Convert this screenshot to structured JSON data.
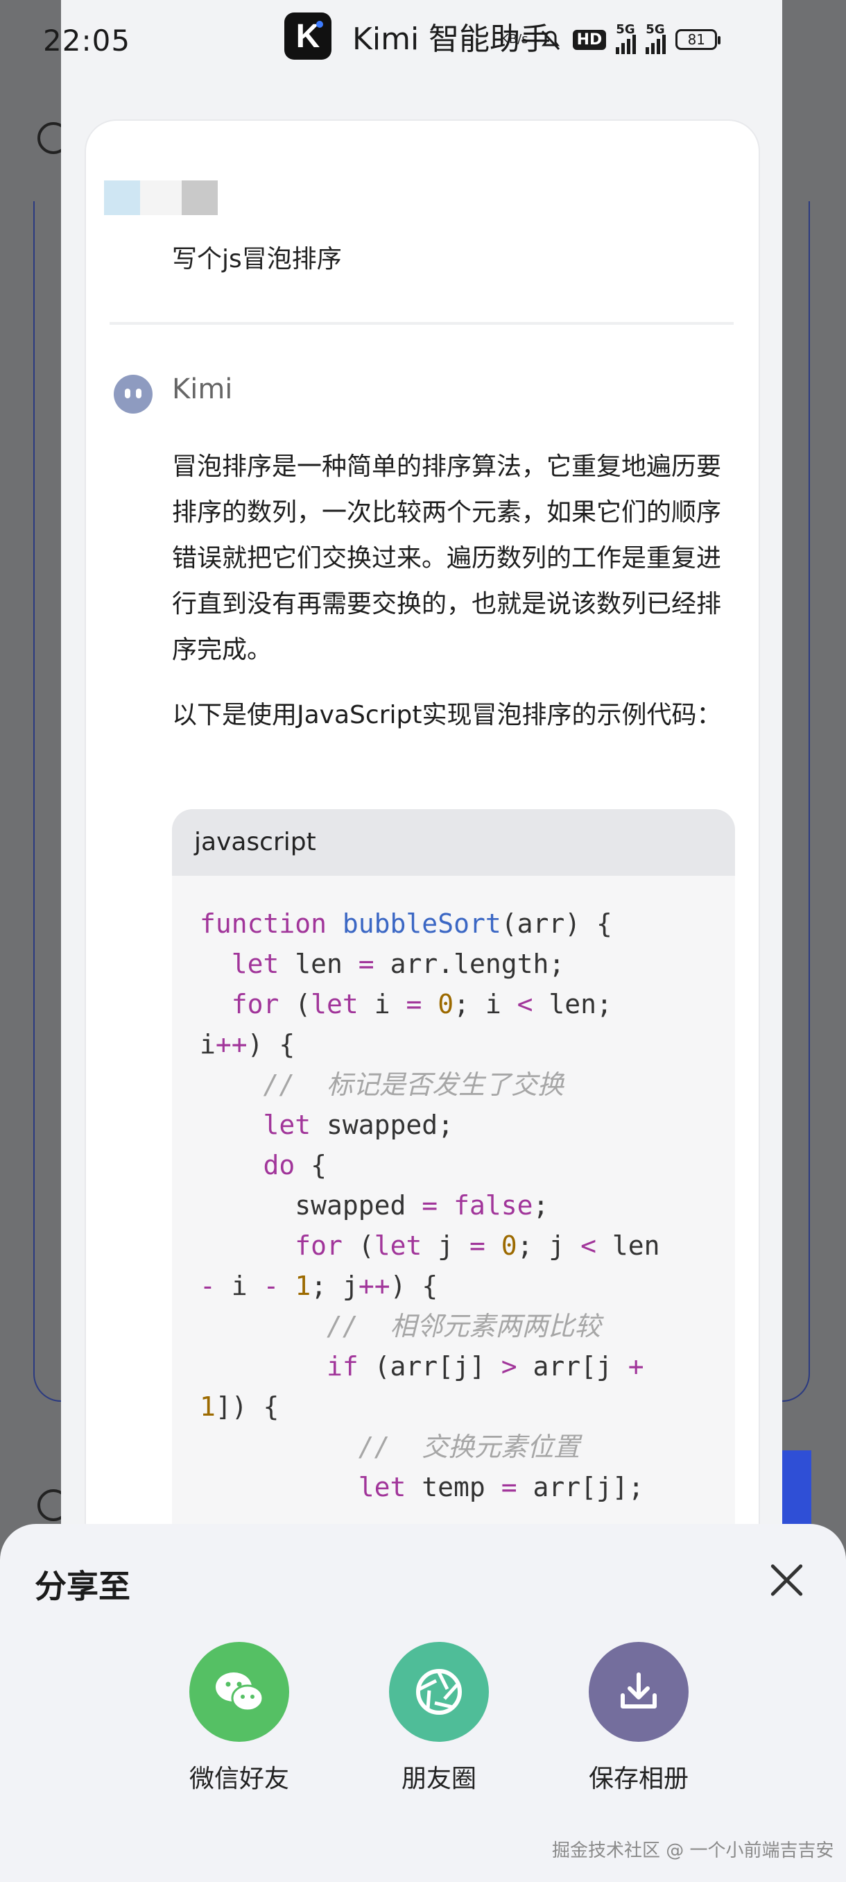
{
  "status_bar": {
    "time": "22:05",
    "net_speed": "KB/s",
    "hd_badge": "HD",
    "signal_label_1": "5G",
    "signal_label_2": "5G",
    "battery": "81"
  },
  "app": {
    "logo_letter": "K",
    "title": "Kimi 智能助手"
  },
  "chat": {
    "user_message": "写个js冒泡排序",
    "assistant_name": "Kimi",
    "paragraph_1": "冒泡排序是一种简单的排序算法，它重复地遍历要排序的数列，一次比较两个元素，如果它们的顺序错误就把它们交换过来。遍历数列的工作是重复进行直到没有再需要交换的，也就是说该数列已经排序完成。",
    "paragraph_2": "以下是使用JavaScript实现冒泡排序的示例代码：",
    "code_language": "javascript",
    "code_lines": [
      [
        [
          "kw",
          "function"
        ],
        [
          "",
          " "
        ],
        [
          "fn",
          "bubbleSort"
        ],
        [
          "",
          "(arr) {"
        ]
      ],
      [
        [
          "",
          "  "
        ],
        [
          "kw",
          "let"
        ],
        [
          "",
          " len "
        ],
        [
          "kw",
          "="
        ],
        [
          "",
          " arr.length;"
        ]
      ],
      [
        [
          "",
          "  "
        ],
        [
          "kw",
          "for"
        ],
        [
          "",
          " ("
        ],
        [
          "kw",
          "let"
        ],
        [
          "",
          " i "
        ],
        [
          "kw",
          "="
        ],
        [
          "",
          " "
        ],
        [
          "num",
          "0"
        ],
        [
          "",
          "; i "
        ],
        [
          "kw",
          "<"
        ],
        [
          "",
          " len;"
        ]
      ],
      [
        [
          "",
          "i"
        ],
        [
          "kw",
          "++"
        ],
        [
          "",
          ") {"
        ]
      ],
      [
        [
          "",
          "    "
        ],
        [
          "cm",
          "//  标记是否发生了交换"
        ]
      ],
      [
        [
          "",
          "    "
        ],
        [
          "kw",
          "let"
        ],
        [
          "",
          " swapped;"
        ]
      ],
      [
        [
          "",
          "    "
        ],
        [
          "kw",
          "do"
        ],
        [
          "",
          " {"
        ]
      ],
      [
        [
          "",
          "      swapped "
        ],
        [
          "kw",
          "="
        ],
        [
          "",
          " "
        ],
        [
          "bool",
          "false"
        ],
        [
          "",
          ";"
        ]
      ],
      [
        [
          "",
          "      "
        ],
        [
          "kw",
          "for"
        ],
        [
          "",
          " ("
        ],
        [
          "kw",
          "let"
        ],
        [
          "",
          " j "
        ],
        [
          "kw",
          "="
        ],
        [
          "",
          " "
        ],
        [
          "num",
          "0"
        ],
        [
          "",
          "; j "
        ],
        [
          "kw",
          "<"
        ],
        [
          "",
          " len"
        ]
      ],
      [
        [
          "kw",
          "-"
        ],
        [
          "",
          " i "
        ],
        [
          "kw",
          "-"
        ],
        [
          "",
          " "
        ],
        [
          "num",
          "1"
        ],
        [
          "",
          "; j"
        ],
        [
          "kw",
          "++"
        ],
        [
          "",
          ") {"
        ]
      ],
      [
        [
          "",
          "        "
        ],
        [
          "cm",
          "//  相邻元素两两比较"
        ]
      ],
      [
        [
          "",
          "        "
        ],
        [
          "kw",
          "if"
        ],
        [
          "",
          " (arr[j] "
        ],
        [
          "kw",
          ">"
        ],
        [
          "",
          " arr[j "
        ],
        [
          "kw",
          "+"
        ]
      ],
      [
        [
          "num",
          "1"
        ],
        [
          "",
          "]) {"
        ]
      ],
      [
        [
          "",
          "          "
        ],
        [
          "cm",
          "//  交换元素位置"
        ]
      ],
      [
        [
          "",
          "          "
        ],
        [
          "kw",
          "let"
        ],
        [
          "",
          " temp "
        ],
        [
          "kw",
          "="
        ],
        [
          "",
          " arr[j];"
        ]
      ]
    ]
  },
  "share_sheet": {
    "title": "分享至",
    "options": [
      {
        "label": "微信好友",
        "icon": "wechat-icon"
      },
      {
        "label": "朋友圈",
        "icon": "moments-shutter-icon"
      },
      {
        "label": "保存相册",
        "icon": "download-icon"
      }
    ]
  },
  "watermark": "掘金技术社区 @ 一个小前端吉吉安",
  "colors": {
    "wechat_green": "#55c064",
    "moments_teal": "#4fbd98",
    "save_purple": "#746e9d",
    "code_keyword": "#a1359a",
    "code_function": "#3b67c4",
    "code_number": "#9c6a00",
    "code_comment": "#a6a6a6"
  }
}
